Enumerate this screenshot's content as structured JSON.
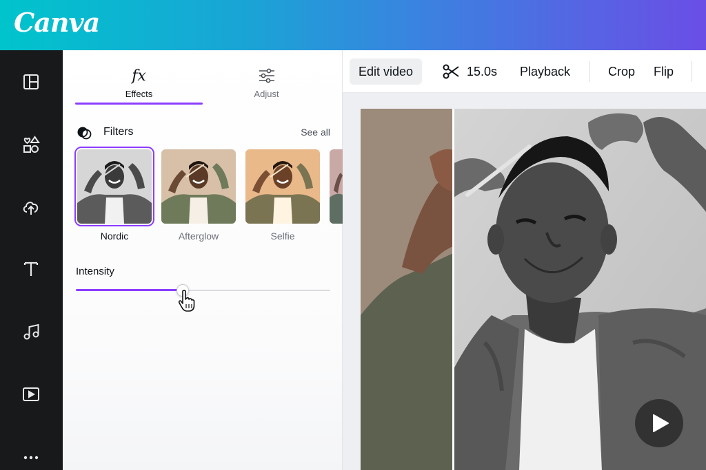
{
  "brand": {
    "name": "Canva"
  },
  "rail": {
    "items": [
      {
        "icon": "layout-icon"
      },
      {
        "icon": "elements-icon"
      },
      {
        "icon": "upload-icon"
      },
      {
        "icon": "text-icon"
      },
      {
        "icon": "audio-icon"
      },
      {
        "icon": "video-icon"
      },
      {
        "icon": "more-icon"
      }
    ]
  },
  "panel": {
    "tabs": [
      {
        "label": "Effects",
        "icon": "fx-icon",
        "glyph": "fx",
        "active": true
      },
      {
        "label": "Adjust",
        "icon": "sliders-icon",
        "active": false
      }
    ],
    "filters": {
      "title": "Filters",
      "see_all": "See all",
      "items": [
        {
          "label": "Nordic",
          "selected": true
        },
        {
          "label": "Afterglow",
          "selected": false
        },
        {
          "label": "Selfie",
          "selected": false
        }
      ]
    },
    "intensity": {
      "label": "Intensity",
      "value": 0.42
    }
  },
  "toolbar": {
    "edit_video": "Edit video",
    "duration": "15.0s",
    "playback": "Playback",
    "crop": "Crop",
    "flip": "Flip"
  },
  "colors": {
    "accent": "#8b3dff",
    "rail_bg": "#18191b"
  }
}
